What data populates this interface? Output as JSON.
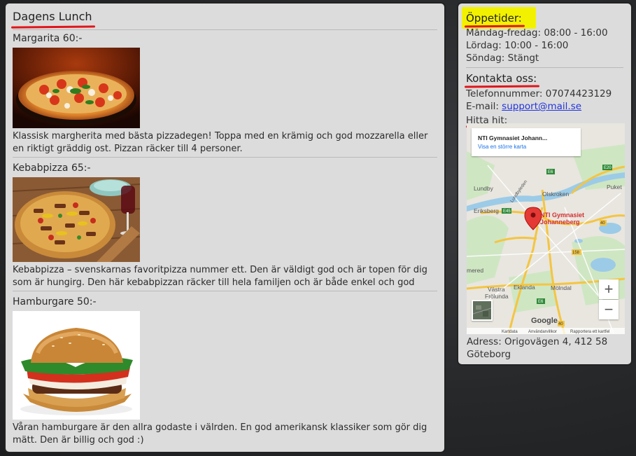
{
  "lunch": {
    "title": "Dagens Lunch",
    "dishes": [
      {
        "name": "Margarita 60:-",
        "description": "Klassisk margherita med bästa pizzadegen! Toppa med en krämig och god mozzarella eller en riktigt gräddig ost. Pizzan räcker till 4 personer."
      },
      {
        "name": "Kebabpizza 65:-",
        "description": "Kebabpizza – svenskarnas favoritpizza nummer ett. Den är väldigt god och är topen för dig som är hungirg. Den här kebabpizzan räcker till hela familjen och är både enkel och god"
      },
      {
        "name": "Hamburgare 50:-",
        "description": "Våran hamburgare är den allra godaste i välrden. En god amerikansk klassiker som gör dig mätt. Den är billig och god :)"
      }
    ]
  },
  "hours": {
    "title": "Öppetider:",
    "rows": [
      "Måndag-fredag: 08:00 - 16:00",
      "Lördag: 10:00 - 16:00",
      "Söndag: Stängt"
    ]
  },
  "contact": {
    "title": "Kontakta oss:",
    "phone": "Telefonnummer: 07074423129",
    "email_label": "E-mail:",
    "email": "support@mail.se",
    "find_label": "Hitta hit:"
  },
  "map": {
    "card_title": "NTI Gymnasiet Johann...",
    "card_link": "Visa en större karta",
    "marker_label_1": "NTI Gymnasiet",
    "marker_label_2": "Johanneberg",
    "places": [
      "Lundby",
      "Olskroken",
      "Puket",
      "Eriksberg",
      "mered",
      "Västra",
      "Frölunda",
      "Eklanda",
      "Mölndal",
      "Lundbyleden"
    ],
    "roads": [
      "E20",
      "E6",
      "E45",
      "40",
      "158",
      "E6",
      "40"
    ],
    "attribution": [
      "Kartdata",
      "Användarvillkor",
      "Rapportera ett kartfel"
    ],
    "brand": "Google"
  },
  "address": "Adress: Origovägen 4, 412 58 Göteborg",
  "colors": {
    "accent_underline": "#e0161b",
    "highlight": "#f2f200",
    "link": "#2233dd",
    "marker": "#e53935"
  }
}
